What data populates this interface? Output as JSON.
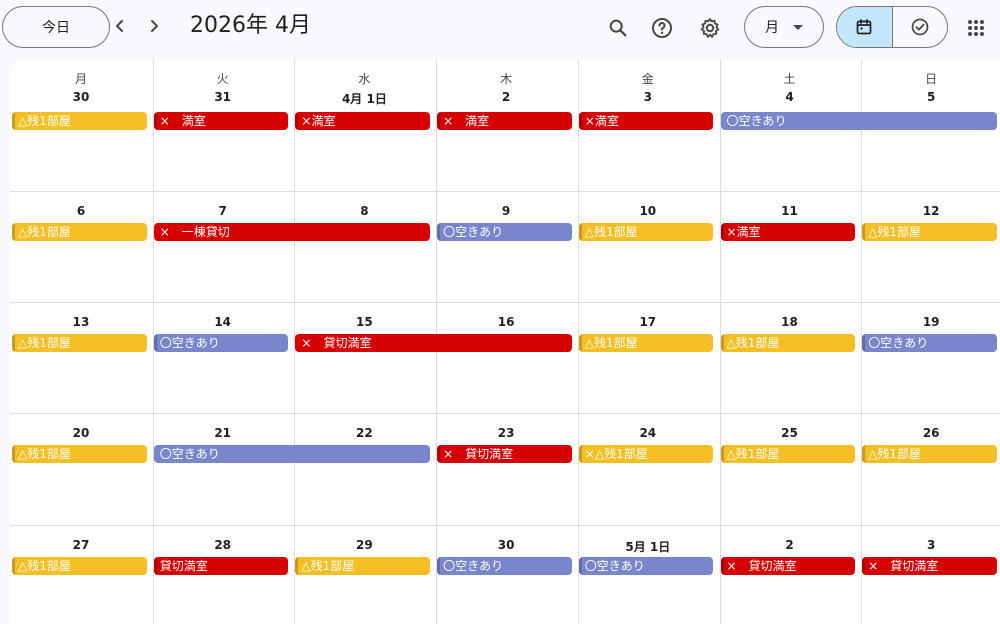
{
  "toolbar": {
    "today_label": "今日",
    "title": "2026年 4月",
    "view_label": "月"
  },
  "weekdays": [
    "月",
    "火",
    "水",
    "木",
    "金",
    "土",
    "日"
  ],
  "weeks": [
    {
      "days": [
        "30",
        "31",
        "4月 1日",
        "2",
        "3",
        "4",
        "5"
      ]
    },
    {
      "days": [
        "6",
        "7",
        "8",
        "9",
        "10",
        "11",
        "12"
      ]
    },
    {
      "days": [
        "13",
        "14",
        "15",
        "16",
        "17",
        "18",
        "19"
      ]
    },
    {
      "days": [
        "20",
        "21",
        "22",
        "23",
        "24",
        "25",
        "26"
      ]
    },
    {
      "days": [
        "27",
        "28",
        "29",
        "30",
        "5月 1日",
        "2",
        "3"
      ]
    }
  ],
  "events": [
    {
      "week": 0,
      "start": 0,
      "span": 1,
      "color": "yellow",
      "label": "△残1部屋"
    },
    {
      "week": 0,
      "start": 1,
      "span": 1,
      "color": "red",
      "label": "×　満室"
    },
    {
      "week": 0,
      "start": 2,
      "span": 1,
      "color": "red",
      "label": "×満室"
    },
    {
      "week": 0,
      "start": 3,
      "span": 1,
      "color": "red",
      "label": "×　満室"
    },
    {
      "week": 0,
      "start": 4,
      "span": 1,
      "color": "red",
      "label": "×満室"
    },
    {
      "week": 0,
      "start": 5,
      "span": 2,
      "color": "blue",
      "label": "〇空きあり"
    },
    {
      "week": 1,
      "start": 0,
      "span": 1,
      "color": "yellow",
      "label": "△残1部屋"
    },
    {
      "week": 1,
      "start": 1,
      "span": 2,
      "color": "red",
      "label": "×　一棟貸切"
    },
    {
      "week": 1,
      "start": 3,
      "span": 1,
      "color": "blue",
      "label": "〇空きあり"
    },
    {
      "week": 1,
      "start": 4,
      "span": 1,
      "color": "yellow",
      "label": "△残1部屋"
    },
    {
      "week": 1,
      "start": 5,
      "span": 1,
      "color": "red",
      "label": "×満室"
    },
    {
      "week": 1,
      "start": 6,
      "span": 1,
      "color": "yellow",
      "label": "△残1部屋"
    },
    {
      "week": 2,
      "start": 0,
      "span": 1,
      "color": "yellow",
      "label": "△残1部屋"
    },
    {
      "week": 2,
      "start": 1,
      "span": 1,
      "color": "blue",
      "label": "〇空きあり"
    },
    {
      "week": 2,
      "start": 2,
      "span": 2,
      "color": "red",
      "label": "×　貸切満室"
    },
    {
      "week": 2,
      "start": 4,
      "span": 1,
      "color": "yellow",
      "label": "△残1部屋"
    },
    {
      "week": 2,
      "start": 5,
      "span": 1,
      "color": "yellow",
      "label": "△残1部屋"
    },
    {
      "week": 2,
      "start": 6,
      "span": 1,
      "color": "blue",
      "label": "〇空きあり"
    },
    {
      "week": 3,
      "start": 0,
      "span": 1,
      "color": "yellow",
      "label": "△残1部屋"
    },
    {
      "week": 3,
      "start": 1,
      "span": 2,
      "color": "blue",
      "label": "〇空きあり"
    },
    {
      "week": 3,
      "start": 3,
      "span": 1,
      "color": "red",
      "label": "×　貸切満室"
    },
    {
      "week": 3,
      "start": 4,
      "span": 1,
      "color": "yellow",
      "label": "×△残1部屋"
    },
    {
      "week": 3,
      "start": 5,
      "span": 1,
      "color": "yellow",
      "label": "△残1部屋"
    },
    {
      "week": 3,
      "start": 6,
      "span": 1,
      "color": "yellow",
      "label": "△残1部屋"
    },
    {
      "week": 4,
      "start": 0,
      "span": 1,
      "color": "yellow",
      "label": "△残1部屋"
    },
    {
      "week": 4,
      "start": 1,
      "span": 1,
      "color": "red",
      "label": "貸切満室"
    },
    {
      "week": 4,
      "start": 2,
      "span": 1,
      "color": "yellow",
      "label": "△残1部屋"
    },
    {
      "week": 4,
      "start": 3,
      "span": 1,
      "color": "blue",
      "label": "〇空きあり"
    },
    {
      "week": 4,
      "start": 4,
      "span": 1,
      "color": "blue",
      "label": "〇空きあり"
    },
    {
      "week": 4,
      "start": 5,
      "span": 1,
      "color": "red",
      "label": "×　貸切満室"
    },
    {
      "week": 4,
      "start": 6,
      "span": 1,
      "color": "red",
      "label": "×　貸切満室"
    }
  ]
}
